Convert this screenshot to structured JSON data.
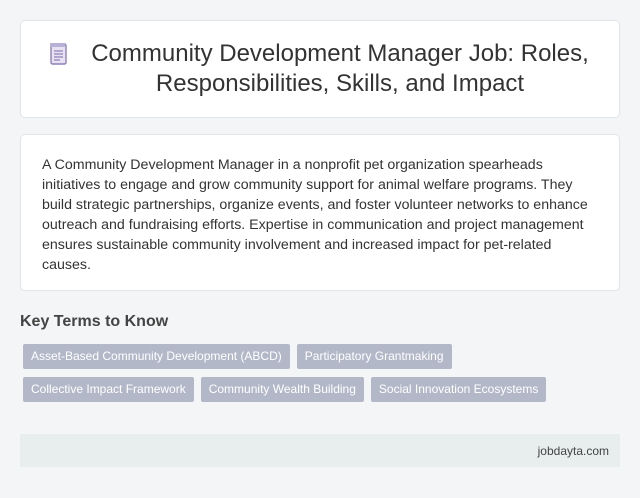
{
  "header": {
    "title": "Community Development Manager Job: Roles, Responsibilities, Skills, and Impact",
    "icon": "document-icon"
  },
  "description": {
    "text": "A Community Development Manager in a nonprofit pet organization spearheads initiatives to engage and grow community support for animal welfare programs. They build strategic partnerships, organize events, and foster volunteer networks to enhance outreach and fundraising efforts. Expertise in communication and project management ensures sustainable community involvement and increased impact for pet-related causes."
  },
  "key_terms": {
    "heading": "Key Terms to Know",
    "tags": [
      "Asset-Based Community Development (ABCD)",
      "Participatory Grantmaking",
      "Collective Impact Framework",
      "Community Wealth Building",
      "Social Innovation Ecosystems"
    ]
  },
  "footer": {
    "site": "jobdayta.com"
  },
  "colors": {
    "background": "#f3f5f6",
    "card": "#ffffff",
    "tag": "#b3b8c9",
    "footer": "#e8edee",
    "icon_accent": "#8e7fb8"
  }
}
